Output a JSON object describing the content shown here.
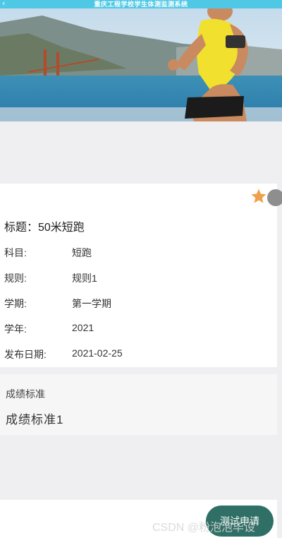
{
  "app": {
    "title": "重庆工程学校学生体测监测系统"
  },
  "banner": {
    "description_icon": "runner-photo"
  },
  "detail": {
    "headline": "标题：50米短跑",
    "fields": [
      {
        "label": "科目:",
        "value": "短跑"
      },
      {
        "label": "规则:",
        "value": "规则1"
      },
      {
        "label": "学期:",
        "value": "第一学期"
      },
      {
        "label": "学年:",
        "value": "2021"
      },
      {
        "label": "发布日期:",
        "value": "2021-02-25"
      }
    ],
    "favorite_icon": "star-icon",
    "favorite_color": "#f0a04b"
  },
  "score": {
    "caption": "成绩标准",
    "content": "成绩标准1"
  },
  "action": {
    "apply_label": "测试申请",
    "color": "#2f6f66"
  },
  "watermark": "CSDN @粉泡泡毕设"
}
